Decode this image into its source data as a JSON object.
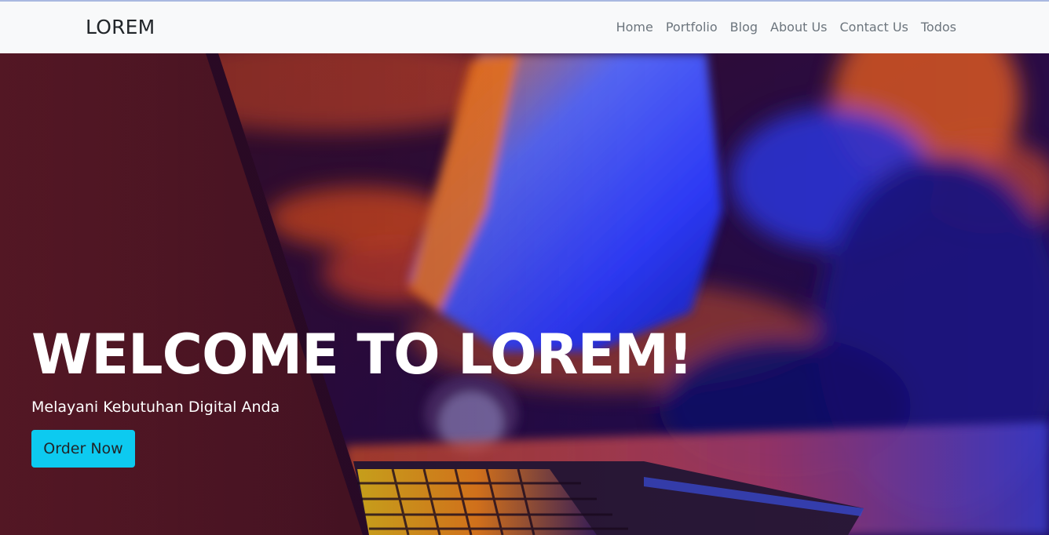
{
  "navbar": {
    "brand": "LOREM",
    "items": [
      {
        "label": "Home"
      },
      {
        "label": "Portfolio"
      },
      {
        "label": "Blog"
      },
      {
        "label": "About Us"
      },
      {
        "label": "Contact Us"
      },
      {
        "label": "Todos"
      }
    ]
  },
  "hero": {
    "title": "WELCOME TO LOREM!",
    "subtitle": "Melayani Kebutuhan Digital Anda",
    "cta_label": "Order Now",
    "background_image": "person-typing-on-laptop-neon-lit"
  },
  "colors": {
    "navbar_bg": "#f8f9fa",
    "brand_text": "#212529",
    "nav_link": "#6c757d",
    "cta_bg": "#0dcaf0",
    "hero_text": "#ffffff"
  }
}
